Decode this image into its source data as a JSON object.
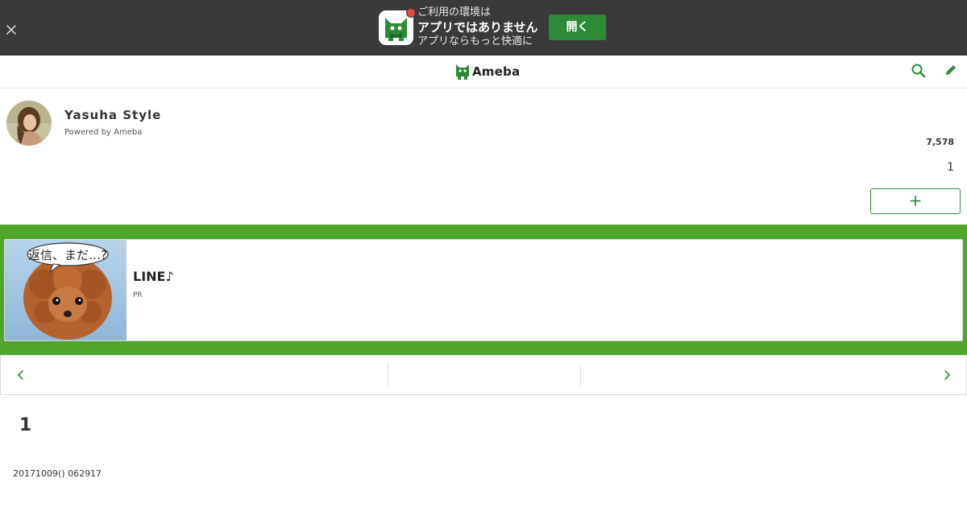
{
  "banner": {
    "line1": "ご利用の環境は",
    "line2": "アプリではありません",
    "line3": "アプリならもっと快適に",
    "open_label": "開く"
  },
  "header": {
    "logo_text": "Ameba"
  },
  "blog": {
    "title": "Yasuha Style",
    "powered": "Powered by Ameba",
    "reader_count": "7,578",
    "count_one": "1",
    "follow_label": "+"
  },
  "ad": {
    "title": "LINE♪",
    "pr": "PR",
    "bubble_text": "返信、まだ…?"
  },
  "article": {
    "number": "1",
    "date": "20171009() 062917"
  },
  "colors": {
    "banner_bg": "#3a3a3a",
    "open_button": "#2d8a37",
    "ameba_green": "#2d8a37",
    "ad_band": "#4ea72a",
    "notification_dot": "#e84b3c"
  },
  "icons": {
    "close": "close-icon",
    "search": "search-icon",
    "edit": "pencil-icon",
    "prev": "chevron-left-icon",
    "next": "chevron-right-icon"
  }
}
